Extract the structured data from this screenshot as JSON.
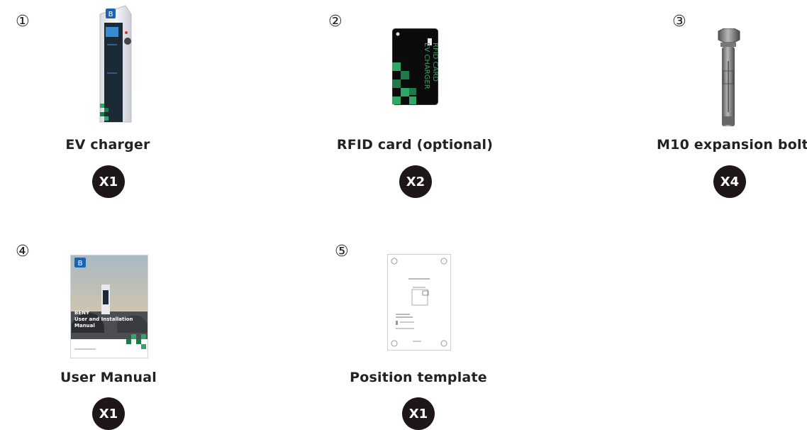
{
  "items": [
    {
      "number": "①",
      "label": "EV charger",
      "quantity": "X1",
      "icon": "ev-charger-icon"
    },
    {
      "number": "②",
      "label": "RFID card (optional)",
      "quantity": "X2",
      "icon": "rfid-card-icon",
      "card_text": [
        "EV CHARGER",
        "RFID CARD"
      ]
    },
    {
      "number": "③",
      "label": "M10 expansion bolt",
      "quantity": "X4",
      "icon": "expansion-bolt-icon"
    },
    {
      "number": "④",
      "label": "User Manual",
      "quantity": "X1",
      "icon": "user-manual-icon",
      "cover_text": [
        "BENY",
        "User and Installation",
        "Manual"
      ]
    },
    {
      "number": "⑤",
      "label": "Position template",
      "quantity": "X1",
      "icon": "position-template-icon"
    }
  ],
  "colors": {
    "badge": "#1f1717",
    "accent_green": "#2fa866",
    "brand_blue": "#1a63b5"
  }
}
